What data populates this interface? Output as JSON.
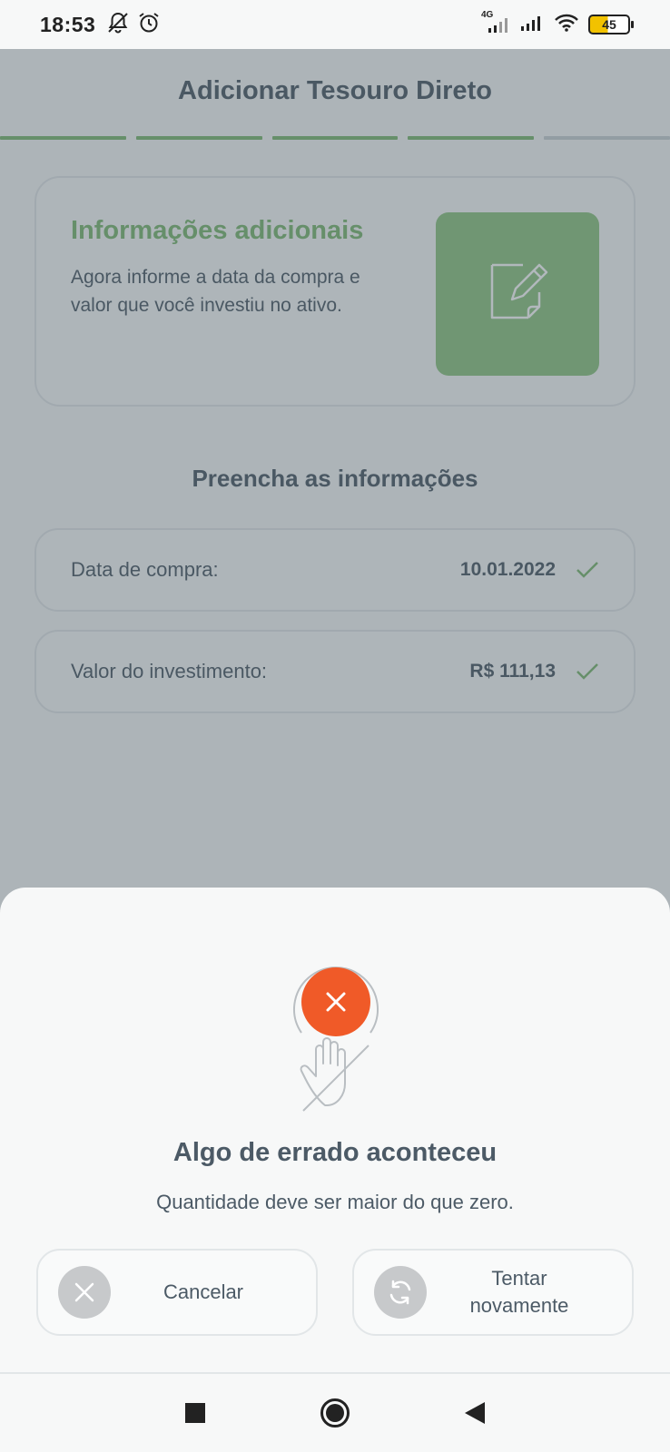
{
  "status_bar": {
    "time": "18:53",
    "network_label": "4G",
    "battery_level": "45"
  },
  "header": {
    "title": "Adicionar Tesouro Direto",
    "progress": {
      "completed_steps": 4,
      "total_steps": 5
    }
  },
  "info_card": {
    "heading": "Informações adicionais",
    "text": "Agora informe a data da compra e valor que você investiu no ativo.",
    "icon": "edit-document-icon"
  },
  "form": {
    "section_title": "Preencha as informações",
    "fields": [
      {
        "label": "Data de compra:",
        "value": "10.01.2022"
      },
      {
        "label": "Valor do investimento:",
        "value": "R$ 111,13"
      }
    ]
  },
  "error_sheet": {
    "title": "Algo de errado aconteceu",
    "message": "Quantidade deve ser maior do que zero.",
    "cancel_label": "Cancelar",
    "retry_label": "Tentar novamente",
    "error_color": "#f05a28"
  },
  "colors": {
    "accent_green": "#7db872",
    "text": "#4c5a66",
    "error": "#f05a28"
  }
}
